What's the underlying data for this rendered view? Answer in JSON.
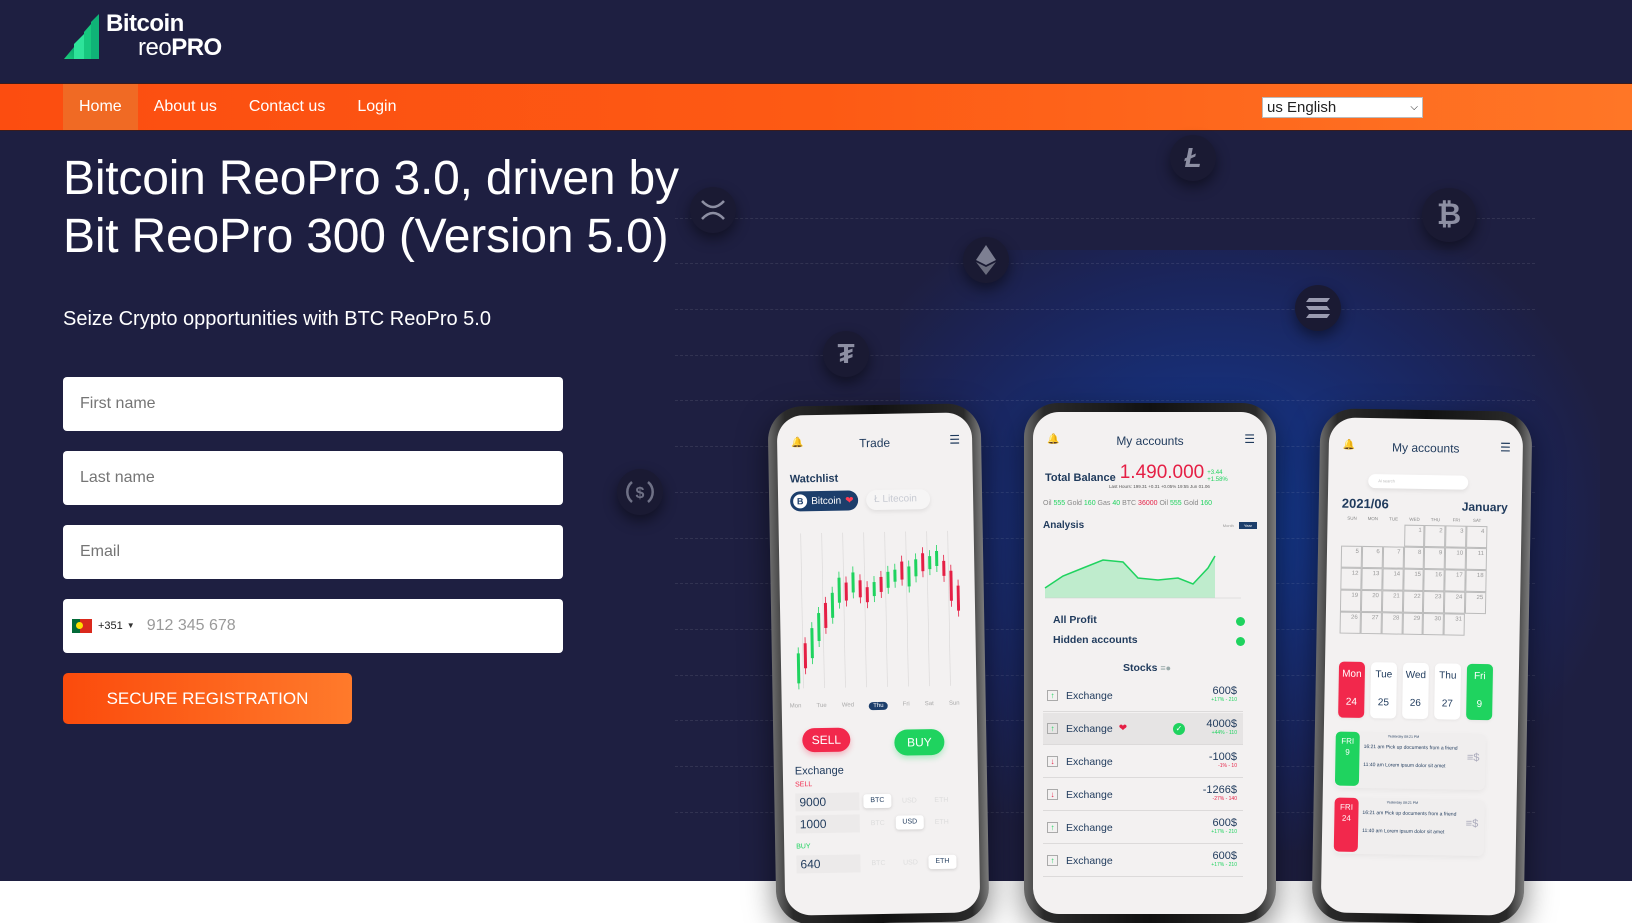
{
  "brand": {
    "line1": "Bitcoin",
    "line2_light": "reo",
    "line2_bold": "PRO"
  },
  "nav": {
    "items": [
      {
        "label": "Home",
        "active": true
      },
      {
        "label": "About us",
        "active": false
      },
      {
        "label": "Contact us",
        "active": false
      },
      {
        "label": "Login",
        "active": false
      }
    ],
    "language": {
      "selected": "us English"
    }
  },
  "hero": {
    "headline": "Bitcoin ReoPro 3.0, driven by Bit ReoPro 300 (Version 5.0)",
    "subheadline": "Seize Crypto opportunities with BTC ReoPro 5.0"
  },
  "form": {
    "first_name_placeholder": "First name",
    "last_name_placeholder": "Last name",
    "email_placeholder": "Email",
    "phone": {
      "country": "Portugal",
      "dial_code": "+351",
      "placeholder": "912 345 678"
    },
    "submit_label": "SECURE REGISTRATION"
  },
  "coins": [
    "xrp",
    "litecoin",
    "ethereum",
    "bitcoin",
    "solana",
    "tether",
    "usd-coin"
  ],
  "phone_trade": {
    "title": "Trade",
    "watchlist_label": "Watchlist",
    "pill_active": "Bitcoin",
    "pill_inactive": "Litecoin",
    "days": [
      "Mon",
      "Tue",
      "Wed",
      "Thu",
      "Fri",
      "Sat",
      "Sun"
    ],
    "selected_day": "Thu",
    "sell_label": "SELL",
    "buy_label": "BUY",
    "exchange_label": "Exchange",
    "sell_section": "SELL",
    "buy_section": "BUY",
    "rows": [
      {
        "value": "9000",
        "tags": [
          "BTC",
          "USD",
          "ETH"
        ],
        "active": "BTC"
      },
      {
        "value": "1000",
        "tags": [
          "BTC",
          "USD",
          "ETH"
        ],
        "active": "USD"
      },
      {
        "value": "640",
        "tags": [
          "BTC",
          "USD",
          "ETH"
        ],
        "active": "ETH"
      }
    ]
  },
  "phone_accounts": {
    "title": "My accounts",
    "total_balance_label": "Total Balance",
    "total_balance_value": "1.490.000",
    "delta_1": "+3.44",
    "delta_2": "+1.58%",
    "last_hours": "Last Hours: 199.31 +0.31 +0.05% 19:55 Jun 01.06",
    "ticker": [
      {
        "name": "Oil",
        "value": "555",
        "tone": "up"
      },
      {
        "name": "Gold",
        "value": "160",
        "tone": "up"
      },
      {
        "name": "Gas",
        "value": "40",
        "tone": "up"
      },
      {
        "name": "BTC",
        "value": "36000",
        "tone": "down"
      },
      {
        "name": "Oil",
        "value": "555",
        "tone": "up"
      },
      {
        "name": "Gold",
        "value": "160",
        "tone": "up"
      }
    ],
    "analysis_label": "Analysis",
    "analysis_tabs": [
      "Month",
      "Year"
    ],
    "analysis_active_tab": "Year",
    "all_profit_label": "All Profit",
    "hidden_accounts_label": "Hidden accounts",
    "stocks_label": "Stocks",
    "transactions": [
      {
        "label": "Exchange",
        "dir": "up",
        "amount": "600$",
        "change": "+17% - 210",
        "highlight": false
      },
      {
        "label": "Exchange",
        "dir": "up",
        "amount": "4000$",
        "change": "+44% - 110",
        "highlight": true
      },
      {
        "label": "Exchange",
        "dir": "down",
        "amount": "-100$",
        "change": "-1% - 10",
        "highlight": false
      },
      {
        "label": "Exchange",
        "dir": "down",
        "amount": "-1266$",
        "change": "-27% - 140",
        "highlight": false
      },
      {
        "label": "Exchange",
        "dir": "up",
        "amount": "600$",
        "change": "+17% - 210",
        "highlight": false
      },
      {
        "label": "Exchange",
        "dir": "up",
        "amount": "600$",
        "change": "+17% - 210",
        "highlight": false
      }
    ]
  },
  "phone_calendar": {
    "title": "My accounts",
    "search_placeholder": "Ai search",
    "year_month": "2021/06",
    "month_name": "January",
    "weekdays": [
      "SUN",
      "MON",
      "TUE",
      "WED",
      "THU",
      "FRI",
      "SAT"
    ],
    "dates": [
      "",
      "",
      "",
      "1",
      "2",
      "3",
      "4",
      "5",
      "6",
      "7",
      "8",
      "9",
      "10",
      "11",
      "12",
      "13",
      "14",
      "15",
      "16",
      "17",
      "18",
      "19",
      "20",
      "21",
      "22",
      "23",
      "24",
      "25",
      "26",
      "27",
      "28",
      "29",
      "30",
      "31",
      "",
      "",
      ""
    ],
    "day_cards": [
      {
        "day": "Mon",
        "date": "24",
        "tone": "red"
      },
      {
        "day": "Tue",
        "date": "25",
        "tone": "plain"
      },
      {
        "day": "Wed",
        "date": "26",
        "tone": "plain"
      },
      {
        "day": "Thu",
        "date": "27",
        "tone": "plain"
      },
      {
        "day": "Fri",
        "date": "9",
        "tone": "green"
      }
    ],
    "events": [
      {
        "day": "FRI",
        "date": "9",
        "tone": "green",
        "header": "Yesterday 08:21 PM",
        "time1": "16:21 am",
        "text1": "Pick up documents from a friend",
        "time2": "11:40 am",
        "text2": "Lorem ipsum dolor sit amet"
      },
      {
        "day": "FRI",
        "date": "24",
        "tone": "red",
        "header": "Yesterday 08:21 PM",
        "time1": "16:21 am",
        "text1": "Pick up documents from a friend",
        "time2": "11:40 am",
        "text2": "Lorem ipsum dolor sit amet"
      }
    ]
  }
}
